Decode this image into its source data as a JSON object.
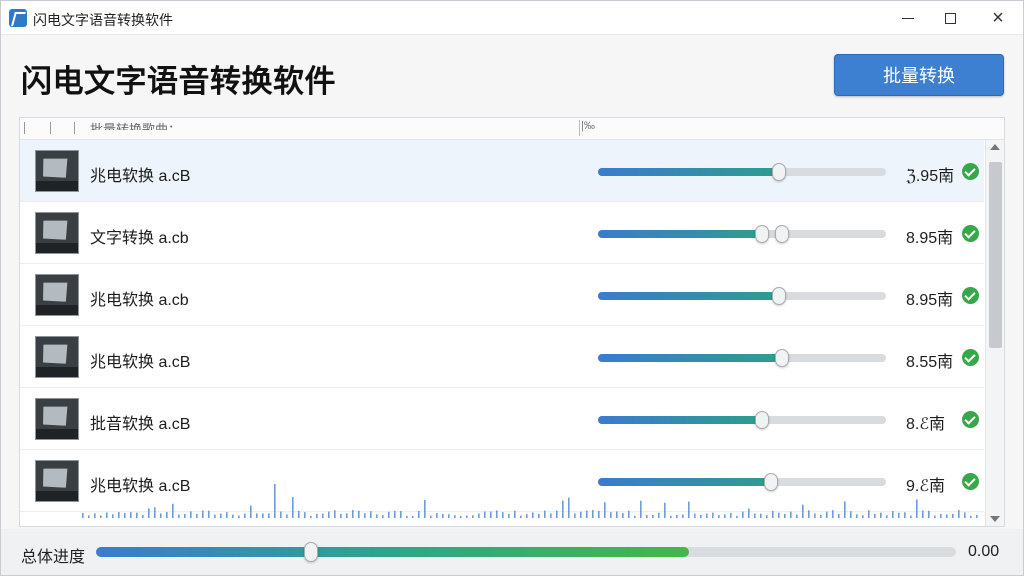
{
  "window": {
    "title": "闪电文字语音转换软件"
  },
  "header": {
    "title": "闪电文字语音转换软件",
    "batch_button": "批量转换"
  },
  "list": {
    "header": {
      "name_col": "批量转换歌曲：",
      "progress_col": "|‰"
    },
    "rows": [
      {
        "name": "兆电软换 a.cB",
        "size": "ℨ.95南",
        "progress": 0.63,
        "second_knob": null,
        "selected": true
      },
      {
        "name": "文字转换 a.cb",
        "size": "8.95南",
        "progress": 0.57,
        "second_knob": 0.64,
        "selected": false
      },
      {
        "name": "兆电软换 a.cb",
        "size": "8.95南",
        "progress": 0.63,
        "second_knob": null,
        "selected": false
      },
      {
        "name": "兆电软换 a.cB",
        "size": "8.55南",
        "progress": 0.64,
        "second_knob": null,
        "selected": false
      },
      {
        "name": "批音软换 a.cB",
        "size": "8.ℰ南",
        "progress": 0.57,
        "second_knob": null,
        "selected": false
      },
      {
        "name": "兆电软换 a.cB",
        "size": "9.ℰ南",
        "progress": 0.6,
        "second_knob": null,
        "selected": false
      }
    ]
  },
  "footer": {
    "label": "总体进度",
    "value": "0.00",
    "progress": 0.69,
    "knob": 0.25
  },
  "colors": {
    "accent": "#3d7fd1",
    "success": "#37a84a"
  },
  "icons": [
    "app-logo-icon",
    "minimize-icon",
    "maximize-icon",
    "close-icon",
    "audio-thumbnail-icon",
    "check-circle-icon",
    "scroll-up-icon",
    "scroll-down-icon"
  ]
}
